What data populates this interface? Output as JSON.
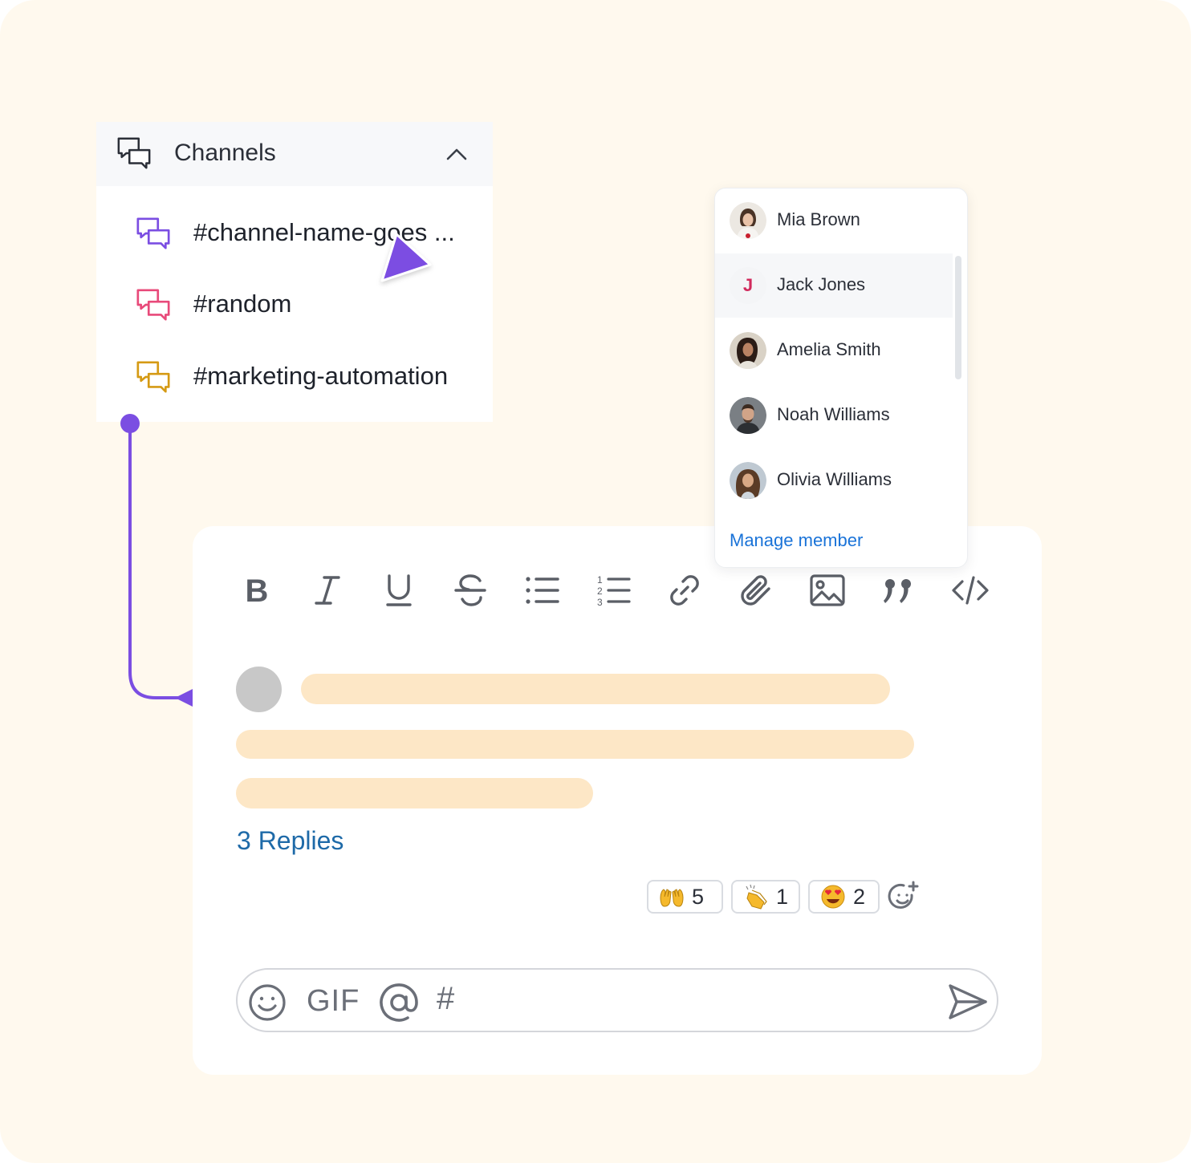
{
  "channels": {
    "title": "Channels",
    "items": [
      {
        "label": "#channel-name-goes ...",
        "color": "#7b4ee2"
      },
      {
        "label": "#random",
        "color": "#e84a7a"
      },
      {
        "label": "#marketing-automation",
        "color": "#d59a14"
      }
    ]
  },
  "connector": {
    "color": "#7b4ee2"
  },
  "toolbar": [
    "bold-icon",
    "italic-icon",
    "underline-icon",
    "strikethrough-icon",
    "bulleted-list-icon",
    "numbered-list-icon",
    "link-icon",
    "attachment-icon",
    "image-icon",
    "quote-icon",
    "code-icon"
  ],
  "message": {
    "replies": "3 Replies",
    "reactions": [
      {
        "emoji": "raising-hands",
        "count": "5"
      },
      {
        "emoji": "clapping-hands",
        "count": "1"
      },
      {
        "emoji": "heart-eyes",
        "count": "2"
      }
    ]
  },
  "composer": {
    "gif": "GIF",
    "hash": "#"
  },
  "members": {
    "list": [
      {
        "name": "Mia Brown"
      },
      {
        "name": "Jack Jones",
        "initial": "J"
      },
      {
        "name": "Amelia Smith"
      },
      {
        "name": "Noah Williams"
      },
      {
        "name": "Olivia Williams"
      }
    ],
    "manage_label": "Manage member"
  },
  "colors": {
    "accent": "#7b4ee2",
    "link": "#1e6aa8",
    "skeleton": "#fde7c6",
    "background": "#fff9ee"
  }
}
